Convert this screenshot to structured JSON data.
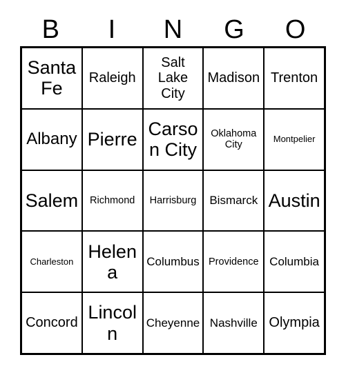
{
  "card": {
    "headers": [
      "B",
      "I",
      "N",
      "G",
      "O"
    ],
    "rows": [
      [
        {
          "label": "Santa Fe",
          "size": "xl"
        },
        {
          "label": "Raleigh",
          "size": "md"
        },
        {
          "label": "Salt Lake City",
          "size": "md"
        },
        {
          "label": "Madison",
          "size": "md"
        },
        {
          "label": "Trenton",
          "size": "md"
        }
      ],
      [
        {
          "label": "Albany",
          "size": "lg"
        },
        {
          "label": "Pierre",
          "size": "xl"
        },
        {
          "label": "Carson City",
          "size": "xl"
        },
        {
          "label": "Oklahoma City",
          "size": "xs"
        },
        {
          "label": "Montpelier",
          "size": "xxs"
        }
      ],
      [
        {
          "label": "Salem",
          "size": "xl"
        },
        {
          "label": "Richmond",
          "size": "xs"
        },
        {
          "label": "Harrisburg",
          "size": "xs"
        },
        {
          "label": "Bismarck",
          "size": "sm"
        },
        {
          "label": "Austin",
          "size": "xl"
        }
      ],
      [
        {
          "label": "Charleston",
          "size": "xxs"
        },
        {
          "label": "Helena",
          "size": "xl"
        },
        {
          "label": "Columbus",
          "size": "sm"
        },
        {
          "label": "Providence",
          "size": "xs"
        },
        {
          "label": "Columbia",
          "size": "sm"
        }
      ],
      [
        {
          "label": "Concord",
          "size": "md"
        },
        {
          "label": "Lincoln",
          "size": "xl"
        },
        {
          "label": "Cheyenne",
          "size": "sm"
        },
        {
          "label": "Nashville",
          "size": "sm"
        },
        {
          "label": "Olympia",
          "size": "md"
        }
      ]
    ],
    "colors": {
      "grid_line": "#000000",
      "background": "#ffffff",
      "text": "#000000"
    }
  }
}
